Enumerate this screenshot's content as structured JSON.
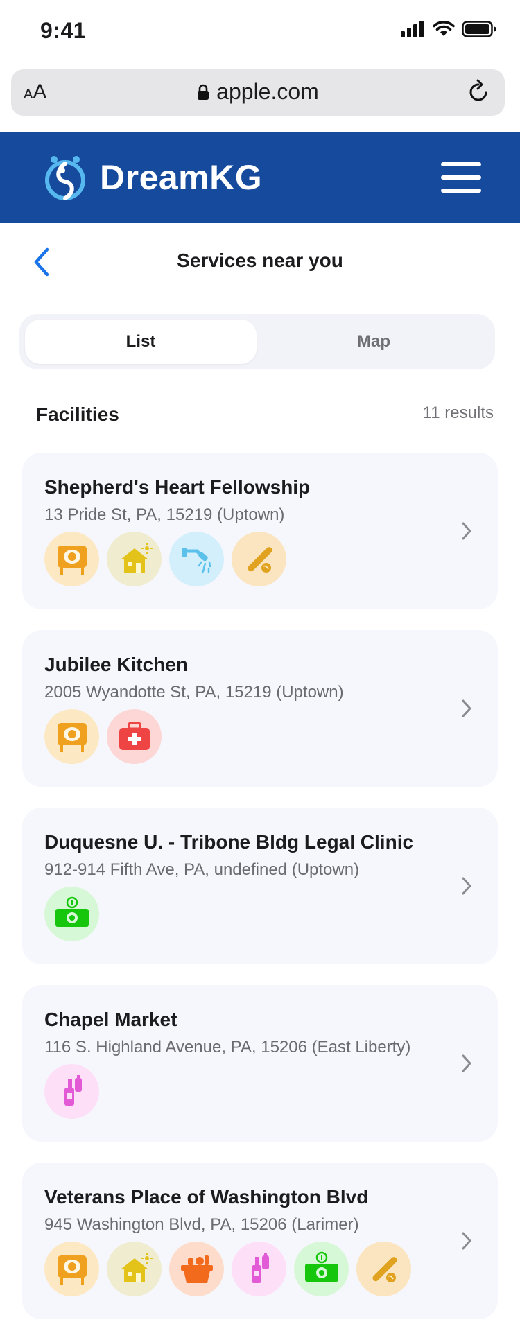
{
  "status": {
    "time": "9:41"
  },
  "browser": {
    "aa_small": "A",
    "aa_large": "A",
    "url": "apple.com"
  },
  "app": {
    "brand": "DreamKG"
  },
  "header": {
    "title": "Services near you"
  },
  "tabs": [
    {
      "label": "List",
      "active": true
    },
    {
      "label": "Map",
      "active": false
    }
  ],
  "section": {
    "title": "Facilities",
    "results": "11 results"
  },
  "facilities": [
    {
      "name": "Shepherd's Heart Fellowship",
      "address": "13 Pride St, PA, 15219 (Uptown)",
      "services": [
        "food-icon",
        "shelter-icon",
        "shower-icon",
        "recreation-icon"
      ]
    },
    {
      "name": "Jubilee Kitchen",
      "address": "2005 Wyandotte St, PA, 15219 (Uptown)",
      "services": [
        "food-icon",
        "medical-icon"
      ]
    },
    {
      "name": "Duquesne U. - Tribone Bldg Legal Clinic",
      "address": "912-914 Fifth Ave, PA, undefined (Uptown)",
      "services": [
        "money-icon"
      ]
    },
    {
      "name": "Chapel Market",
      "address": "116 S. Highland Avenue, PA, 15206 (East Liberty)",
      "services": [
        "hygiene-icon"
      ]
    },
    {
      "name": "Veterans Place of Washington Blvd",
      "address": "945 Washington Blvd, PA, 15206 (Larimer)",
      "services": [
        "food-icon",
        "shelter-icon",
        "groceries-icon",
        "hygiene-icon",
        "money-icon",
        "recreation-icon"
      ]
    }
  ],
  "colors": {
    "brand_blue": "#154a9d",
    "accent_blue": "#1a73e8",
    "food": "#f0a01f",
    "shelter": "#e3c21a",
    "shower": "#5bc1ea",
    "recreation": "#e0a21f",
    "medical": "#ef4444",
    "money": "#16c60c",
    "hygiene": "#e25ad6",
    "groceries": "#f26b1d"
  }
}
